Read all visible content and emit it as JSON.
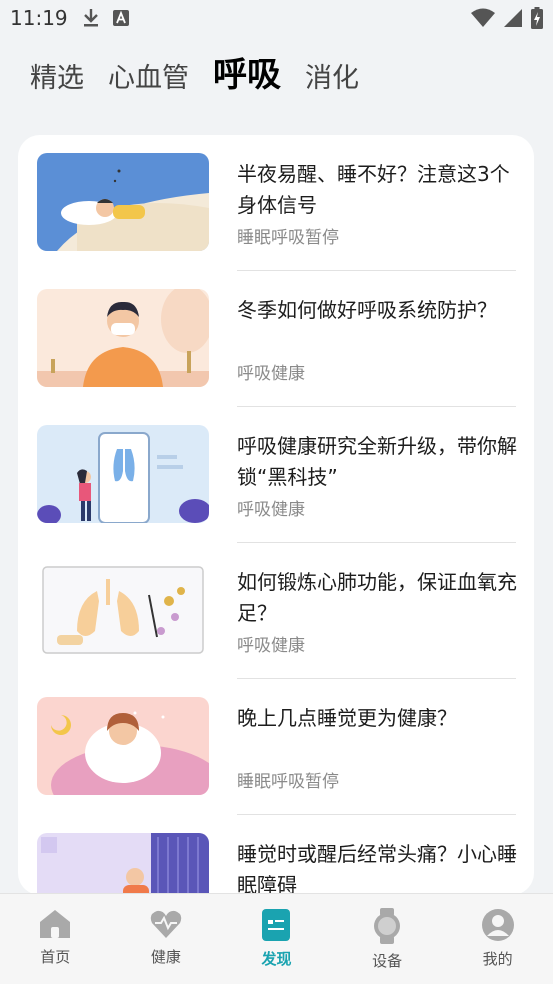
{
  "status_bar": {
    "time": "11:19"
  },
  "tabs": [
    {
      "label": "精选"
    },
    {
      "label": "心血管"
    },
    {
      "label": "呼吸"
    },
    {
      "label": "消化"
    }
  ],
  "articles": [
    {
      "title": "半夜易醒、睡不好？注意这3个身体信号",
      "tag": "睡眠呼吸暂停"
    },
    {
      "title": "冬季如何做好呼吸系统防护？",
      "tag": "呼吸健康"
    },
    {
      "title": "呼吸健康研究全新升级，带你解锁“黑科技”",
      "tag": "呼吸健康"
    },
    {
      "title": "如何锻炼心肺功能，保证血氧充足？",
      "tag": "呼吸健康"
    },
    {
      "title": "晚上几点睡觉更为健康？",
      "tag": "睡眠呼吸暂停"
    },
    {
      "title": "睡觉时或醒后经常头痛？小心睡眠障碍",
      "tag": ""
    }
  ],
  "bottom_nav": [
    {
      "label": "首页"
    },
    {
      "label": "健康"
    },
    {
      "label": "发现"
    },
    {
      "label": "设备"
    },
    {
      "label": "我的"
    }
  ],
  "colors": {
    "accent": "#1aa3b0",
    "icon_gray": "#a9a9a9"
  }
}
